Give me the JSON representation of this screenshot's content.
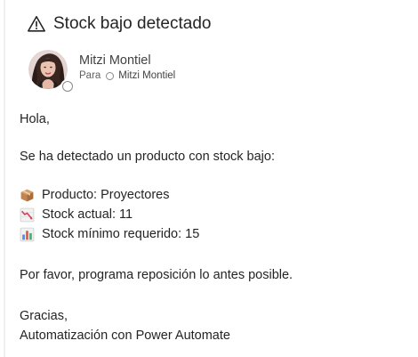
{
  "email": {
    "subject": "Stock bajo detectado",
    "sender_name": "Mitzi Montiel",
    "to_label": "Para",
    "recipient_name": "Mitzi Montiel"
  },
  "icons": {
    "header": "warning-icon",
    "product": "package-icon",
    "stock_actual": "chart-decreasing-icon",
    "stock_min": "bar-chart-icon"
  },
  "body": {
    "greeting": "Hola,",
    "intro": "Se ha detectado un producto con stock bajo:",
    "product_line": "Producto: Proyectores",
    "stock_actual_line": "Stock actual: 11",
    "stock_min_line": "Stock mínimo requerido: 15",
    "request": "Por favor, programa reposición lo antes posible.",
    "closing": "Gracias,",
    "signature": "Automatización con Power Automate"
  },
  "colors": {
    "text": "#242424",
    "muted": "#616161",
    "border": "#f0f0f0"
  }
}
